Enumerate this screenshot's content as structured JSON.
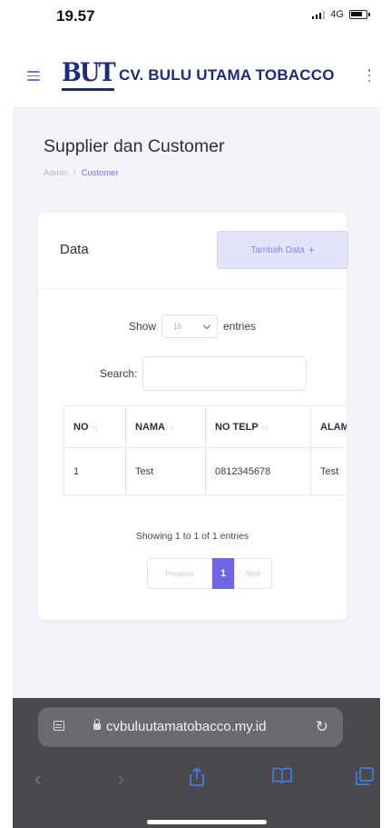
{
  "status_bar": {
    "time": "19.57",
    "network": "4G"
  },
  "header": {
    "logo_text": "BUT",
    "brand_name": "CV. BULU UTAMA TOBACCO"
  },
  "page": {
    "title": "Supplier dan Customer",
    "breadcrumb": {
      "home": "Admin",
      "separator": "/",
      "current": "Customer"
    }
  },
  "card": {
    "title": "Data",
    "add_button_label": "Tambah Data",
    "add_button_icon": "+"
  },
  "datatable": {
    "length": {
      "show_label": "Show",
      "value": "10",
      "entries_label": "entries"
    },
    "search_label": "Search:",
    "search_value": "",
    "columns": [
      "NO",
      "NAMA",
      "NO TELP",
      "ALAMAT"
    ],
    "rows": [
      [
        "1",
        "Test",
        "0812345678",
        "Test"
      ]
    ],
    "info": "Showing 1 to 1 of 1 entries",
    "pagination": {
      "previous": "Previous",
      "current": "1",
      "next": "Next"
    }
  },
  "browser": {
    "url": "cvbuluutamatobacco.my.id"
  },
  "colors": {
    "accent": "#6f66e3",
    "brand": "#1c2b7a",
    "button_bg": "#e5e3fb",
    "content_bg": "#f3f3f9",
    "browser_bg": "#4a4a4c",
    "toolbar_icon": "#3f7ce0"
  },
  "icons": {
    "menu": "hamburger-icon",
    "more": "kebab-icon",
    "sort": "sort-icon",
    "dropdown": "chevron-down-icon",
    "reload": "reload-icon",
    "lock": "lock-icon"
  }
}
